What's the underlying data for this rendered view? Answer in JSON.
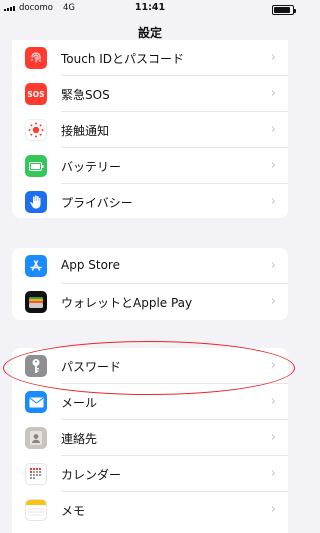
{
  "status_bar": {
    "carrier": "docomo",
    "network": "4G",
    "time": "11:41",
    "battery_level": 0.8
  },
  "nav": {
    "title": "設定"
  },
  "groups": [
    {
      "items": [
        {
          "label": "Touch IDとパスコード",
          "icon": "fingerprint-icon",
          "color": "#ff3b30"
        },
        {
          "label": "緊急SOS",
          "icon": "sos-icon",
          "icon_text": "SOS",
          "color": "#ff3b30"
        },
        {
          "label": "接触通知",
          "icon": "exposure-icon",
          "color": "#ffffff"
        },
        {
          "label": "バッテリー",
          "icon": "battery-icon",
          "color": "#34c759"
        },
        {
          "label": "プライバシー",
          "icon": "hand-icon",
          "color": "#1e6ff0"
        }
      ]
    },
    {
      "items": [
        {
          "label": "App Store",
          "icon": "app-store-icon",
          "color": "#1a8cff"
        },
        {
          "label": "ウォレットとApple Pay",
          "icon": "wallet-icon",
          "color": "#111111"
        }
      ]
    },
    {
      "items": [
        {
          "label": "パスワード",
          "icon": "key-icon",
          "color": "#8e8e93"
        },
        {
          "label": "メール",
          "icon": "mail-icon",
          "color": "#1a8cff"
        },
        {
          "label": "連絡先",
          "icon": "contacts-icon",
          "color": "#c9c4bd"
        },
        {
          "label": "カレンダー",
          "icon": "calendar-icon",
          "color": "#ffffff"
        },
        {
          "label": "メモ",
          "icon": "notes-icon",
          "color": "#ffffff"
        }
      ]
    }
  ],
  "annotation_color": "#e8262b"
}
